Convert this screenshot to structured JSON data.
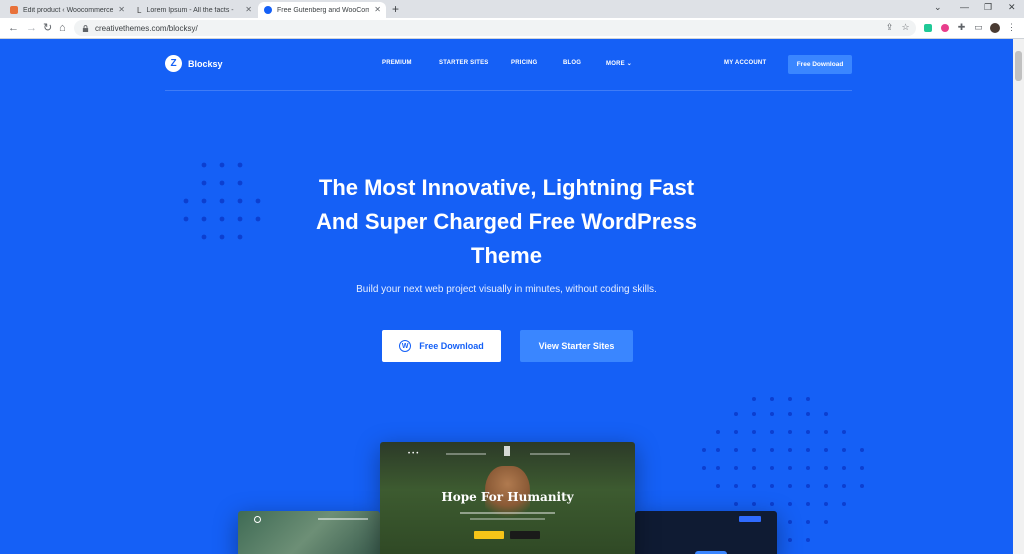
{
  "browser": {
    "tabs": [
      {
        "title": "Edit product ‹ Woocommercepr...",
        "active": false
      },
      {
        "title": "Lorem Ipsum - All the facts - Lip...",
        "active": false
      },
      {
        "title": "Free Gutenberg and WooComme...",
        "active": true
      }
    ],
    "url": "creativethemes.com/blocksy/"
  },
  "site": {
    "brand": "Blocksy",
    "nav": {
      "premium": "PREMIUM",
      "starter_sites": "STARTER SITES",
      "pricing": "PRICING",
      "blog": "BLOG",
      "more": "MORE"
    },
    "my_account": "MY ACCOUNT",
    "header_cta": "Free Download",
    "hero": {
      "title_line1": "The Most Innovative, Lightning Fast",
      "title_line2": "And Super Charged Free WordPress",
      "title_line3": "Theme",
      "subtitle": "Build your next web project visually in minutes, without coding skills.",
      "primary_cta": "Free Download",
      "secondary_cta": "View Starter Sites"
    },
    "preview": {
      "title": "Hope For Humanity"
    }
  },
  "colors": {
    "brand_blue": "#1560f6",
    "accent_blue": "#3a86ff",
    "chrome_tabbar": "#dee1e6"
  }
}
